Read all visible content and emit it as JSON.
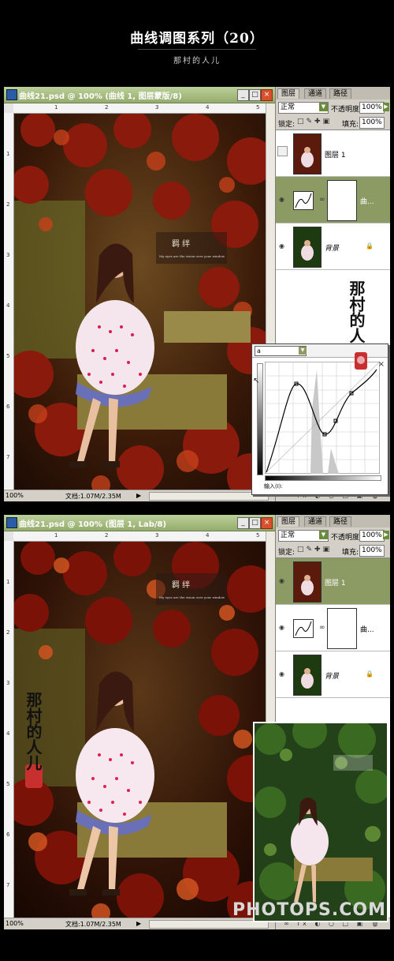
{
  "header": {
    "title": "曲线调图系列（20）",
    "author": "那村的人儿"
  },
  "panel1": {
    "window_title": "曲线21.psd @ 100% (曲线 1, 图层蒙版/8)",
    "zoom": "100%",
    "doc_info": "文档:1.07M/2.35M",
    "tabs": [
      "图层",
      "通道",
      "路径"
    ],
    "blend_mode": "正常",
    "opacity_label": "不透明度:",
    "opacity": "100%",
    "lock_label": "锁定:",
    "fill_label": "填充:",
    "fill": "100%",
    "layers": [
      {
        "name": "图层 1",
        "selected": false,
        "visible": false
      },
      {
        "name": "曲...",
        "selected": true,
        "visible": true
      },
      {
        "name": "背景",
        "selected": false,
        "visible": true
      }
    ],
    "curves": {
      "channel": "a",
      "input_label": "输入(I):"
    },
    "signature": "那村的人儿"
  },
  "panel2": {
    "window_title": "曲线21.psd @ 100% (图层 1, Lab/8)",
    "zoom": "100%",
    "doc_info": "文档:1.07M/2.35M",
    "tabs": [
      "图层",
      "通道",
      "路径"
    ],
    "blend_mode": "正常",
    "opacity_label": "不透明度:",
    "opacity": "100%",
    "lock_label": "锁定:",
    "fill_label": "填充:",
    "fill": "100%",
    "layers": [
      {
        "name": "图层 1",
        "selected": true,
        "visible": true
      },
      {
        "name": "曲...",
        "selected": false,
        "visible": true
      },
      {
        "name": "背景",
        "selected": false,
        "visible": true
      }
    ],
    "signature": "那村的人儿"
  },
  "photo_caption": {
    "title": "羁 绊",
    "sub": "My eyes are the vision over your window"
  },
  "watermark": "PHOTOPS.COM",
  "colors": {
    "titlebar": "#94ac6c",
    "selected_layer": "#8c9a64",
    "panel_bg": "#d4d0c8"
  }
}
